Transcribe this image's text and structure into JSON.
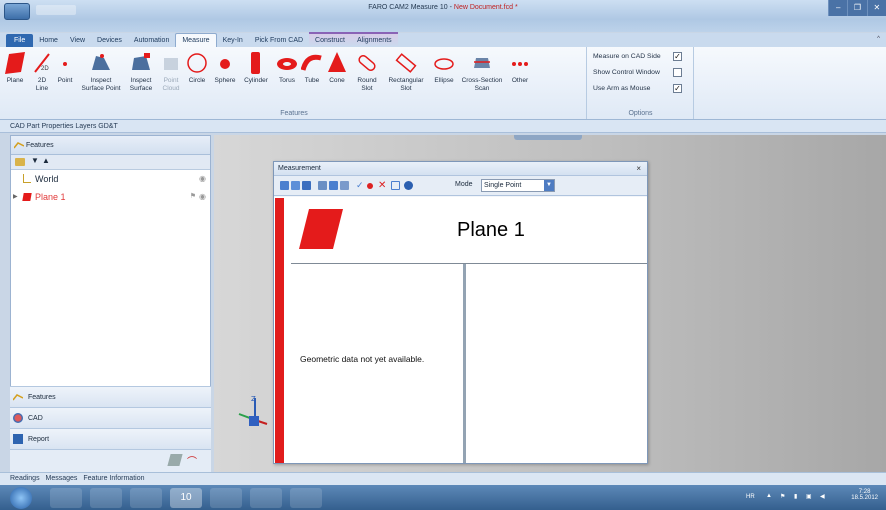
{
  "window": {
    "title_app": "FARO CAM2 Measure 10 - ",
    "title_doc": "New Document.fcd *"
  },
  "ribbon_tabs": [
    "File",
    "Home",
    "View",
    "Devices",
    "Automation",
    "Measure",
    "Key-In",
    "Pick From CAD",
    "Construct",
    "Alignments"
  ],
  "ribbon": {
    "buttons": [
      {
        "label": "Plane",
        "icon": "plane-icon"
      },
      {
        "label": "2D Line",
        "icon": "line-2d-icon"
      },
      {
        "label": "Point",
        "icon": "point-icon"
      },
      {
        "label": "Inspect Surface Point",
        "icon": "inspect-surface-point-icon"
      },
      {
        "label": "Inspect Surface",
        "icon": "inspect-surface-icon"
      },
      {
        "label": "Point Cloud",
        "icon": "point-cloud-icon"
      },
      {
        "label": "Circle",
        "icon": "circle-icon"
      },
      {
        "label": "Sphere",
        "icon": "sphere-icon"
      },
      {
        "label": "Cylinder",
        "icon": "cylinder-icon"
      },
      {
        "label": "Torus",
        "icon": "torus-icon"
      },
      {
        "label": "Tube",
        "icon": "tube-icon"
      },
      {
        "label": "Cone",
        "icon": "cone-icon"
      },
      {
        "label": "Round Slot",
        "icon": "round-slot-icon"
      },
      {
        "label": "Rectangular Slot",
        "icon": "rectangular-slot-icon"
      },
      {
        "label": "Ellipse",
        "icon": "ellipse-icon"
      },
      {
        "label": "Cross-Section Scan",
        "icon": "cross-section-scan-icon"
      },
      {
        "label": "Other",
        "icon": "other-icon"
      }
    ],
    "features_group_label": "Features",
    "options": [
      {
        "label": "Measure on CAD Side",
        "checked": true
      },
      {
        "label": "Show Control Window",
        "checked": false
      },
      {
        "label": "Use Arm as Mouse",
        "checked": true
      }
    ],
    "options_group_label": "Options"
  },
  "cad_props_bar": "CAD Part Properties  Layers  GD&T",
  "left_panel": {
    "header": "Features",
    "tree": [
      {
        "label": "World",
        "color": "#1b2a3c"
      },
      {
        "label": "Plane 1",
        "color": "#e23b3b"
      }
    ],
    "nav": [
      "Features",
      "CAD",
      "Report"
    ]
  },
  "measurement": {
    "title": "Measurement",
    "close": "×",
    "mode_label": "Mode",
    "mode_value": "Single Point",
    "feature_name": "Plane 1",
    "message": "Geometric data not yet available."
  },
  "status_tabs": [
    "Readings",
    "Messages",
    "Feature Information"
  ],
  "taskbar": {
    "tray_lang": "HR",
    "time": "7:28",
    "date": "18.5.2012",
    "measure_badge": "10"
  }
}
